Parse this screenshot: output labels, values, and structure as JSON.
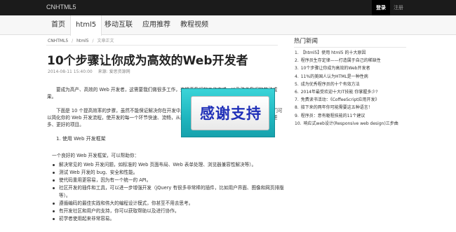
{
  "header": {
    "brand": "CNHTML5",
    "login_label": "登录",
    "register_label": "注册"
  },
  "nav": {
    "items": [
      {
        "label": "首页"
      },
      {
        "label": "html5"
      },
      {
        "label": "移动互联"
      },
      {
        "label": "应用推荐"
      },
      {
        "label": "教程视频"
      }
    ],
    "active": "html5"
  },
  "breadcrumb": {
    "items": [
      "CNHTML5",
      "html5",
      "文章正文"
    ],
    "separator": "/"
  },
  "article": {
    "title": "10个步骤让你成为高效的Web开发者",
    "date": "2014-08-11 15:40:00",
    "source": "来源: 爱思资源网",
    "paragraph1": "要成为高产、高效的 Web 开发者，这需要我们做很多工作，来提高我们的工作方式，以及改善我们的劳动成果。",
    "paragraph2": "下面是 10 个提高效率的步骤，虽然不能保证解决你在开发中所遇到的所有问题，但至少是非常实用的，它们可以简化你的 Web 开发流程，使开发的每一个环节快速、流畅，从而让你将更多的时间用于改进你的作品，开发更多、更好的项目。",
    "section1_title": "1. 使用 Web 开发框架",
    "section1_intro": "一个良好的 Web 开发框架，可以帮助你：",
    "bullets": [
      "解决常见的 Web 开发问题，如标准的 Web 页面布局、Web 表单处理、浏览器兼容性解决等）。",
      "测试 Web 开发的 bug、安全和性能。",
      "使代码重用更容易，因为有一个统一的 API。",
      "社区开发的插件和工具，可以进一步增强开发（jQuery 有很多非常棒的插件，比如用户界面、图像和网页排版等）。",
      "遵循编码的最佳实践和伟大的编程设计模式，你甚至不用去思考。",
      "有开发社区和用户的支持，你可以获取帮助以及进行协作。",
      "初学者使用起来非常容易。"
    ]
  },
  "sidebar": {
    "heading": "热门新闻",
    "items": [
      "【html5】使用 html5 的十大原因",
      "程序员生存定律——打造属于自己的稀缺性",
      "10个步骤让你成为高效的Web开发者",
      "11%的美国人认为HTML是一种性病",
      "成为优秀程序员的十个有效方法",
      "2014年最受欢迎十大IT技能 你掌握多少?",
      "免费读书活动：《CoffeeScript应用开发》",
      "接下来的两年你可能需要这五种语言！",
      "程序员：意有躯程技能的11个建议",
      "响应式web设计(Responsive web design)三步曲"
    ]
  },
  "overlay": {
    "text": "感谢支持"
  }
}
